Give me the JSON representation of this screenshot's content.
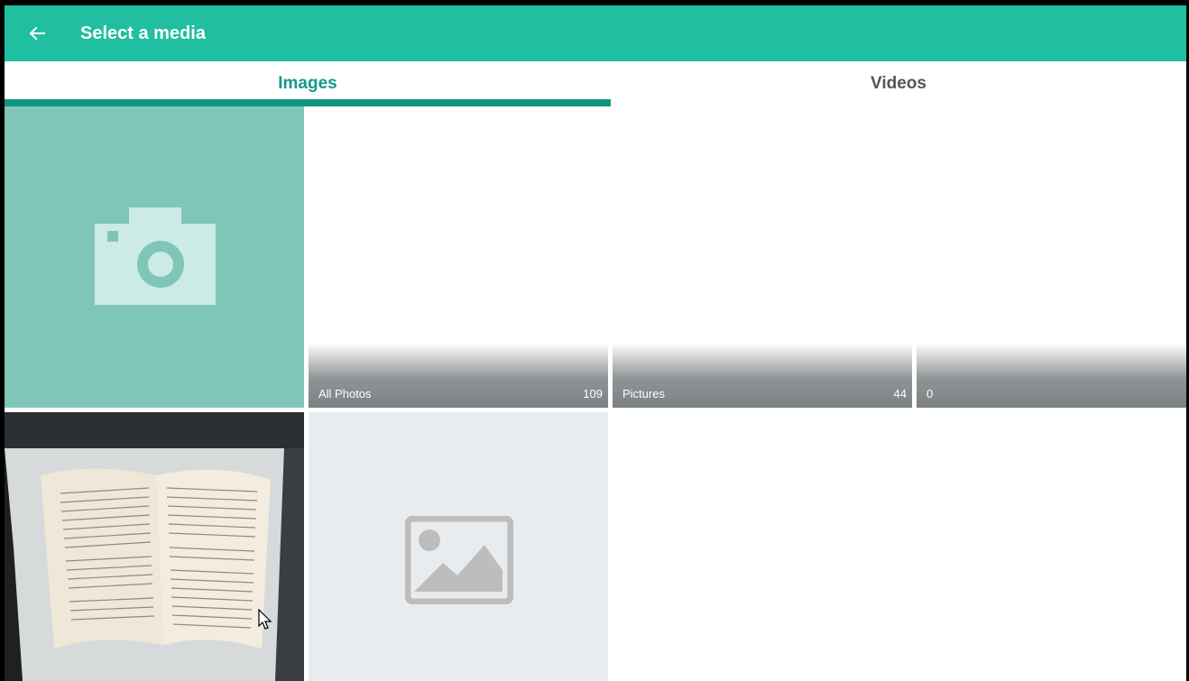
{
  "appbar": {
    "title": "Select a media",
    "back_icon": "arrow-left-icon",
    "color": "#20bf9f"
  },
  "tabs": [
    {
      "label": "Images",
      "selected": true
    },
    {
      "label": "Videos",
      "selected": false
    }
  ],
  "accent": "#0f9583",
  "albums": [
    {
      "label": "All Photos",
      "count": "109"
    },
    {
      "label": "Pictures",
      "count": "44"
    },
    {
      "label": "0",
      "count": ""
    }
  ],
  "tiles": {
    "camera": {
      "icon": "camera-icon"
    },
    "photo": {
      "icon": "book-photo"
    },
    "placeholder": {
      "icon": "image-placeholder-icon"
    }
  }
}
